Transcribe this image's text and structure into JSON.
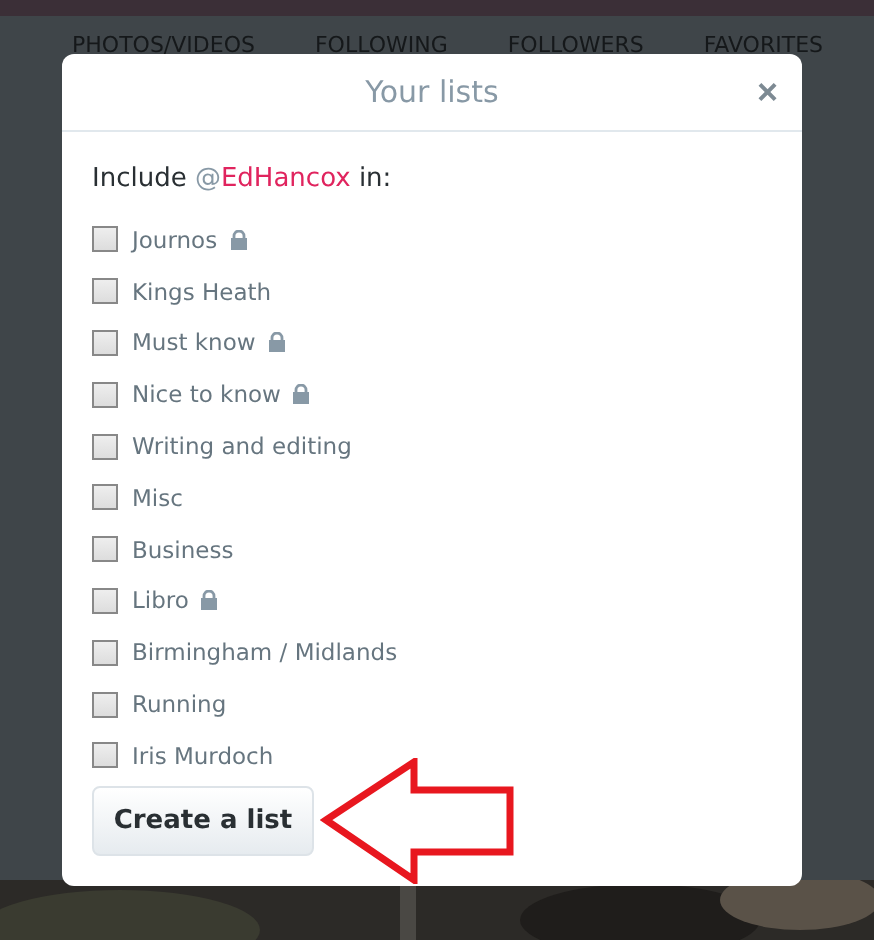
{
  "background": {
    "nav_tabs": [
      {
        "label": "PHOTOS/VIDEOS"
      },
      {
        "label": "FOLLOWING"
      },
      {
        "label": "FOLLOWERS"
      },
      {
        "label": "FAVORITES"
      }
    ]
  },
  "dialog": {
    "title": "Your lists",
    "close": "×",
    "include": {
      "prefix": "Include ",
      "handle_at": "@",
      "handle_name": "EdHancox",
      "suffix": " in:"
    },
    "lists": [
      {
        "name": "Journos",
        "locked": true,
        "checked": false
      },
      {
        "name": "Kings Heath",
        "locked": false,
        "checked": false
      },
      {
        "name": "Must know",
        "locked": true,
        "checked": false
      },
      {
        "name": "Nice to know",
        "locked": true,
        "checked": false
      },
      {
        "name": "Writing and editing",
        "locked": false,
        "checked": false
      },
      {
        "name": "Misc",
        "locked": false,
        "checked": false
      },
      {
        "name": "Business",
        "locked": false,
        "checked": false
      },
      {
        "name": "Libro",
        "locked": true,
        "checked": false
      },
      {
        "name": "Birmingham / Midlands",
        "locked": false,
        "checked": false
      },
      {
        "name": "Running",
        "locked": false,
        "checked": false
      },
      {
        "name": "Iris Murdoch",
        "locked": false,
        "checked": false
      }
    ],
    "create_button": "Create a list"
  }
}
